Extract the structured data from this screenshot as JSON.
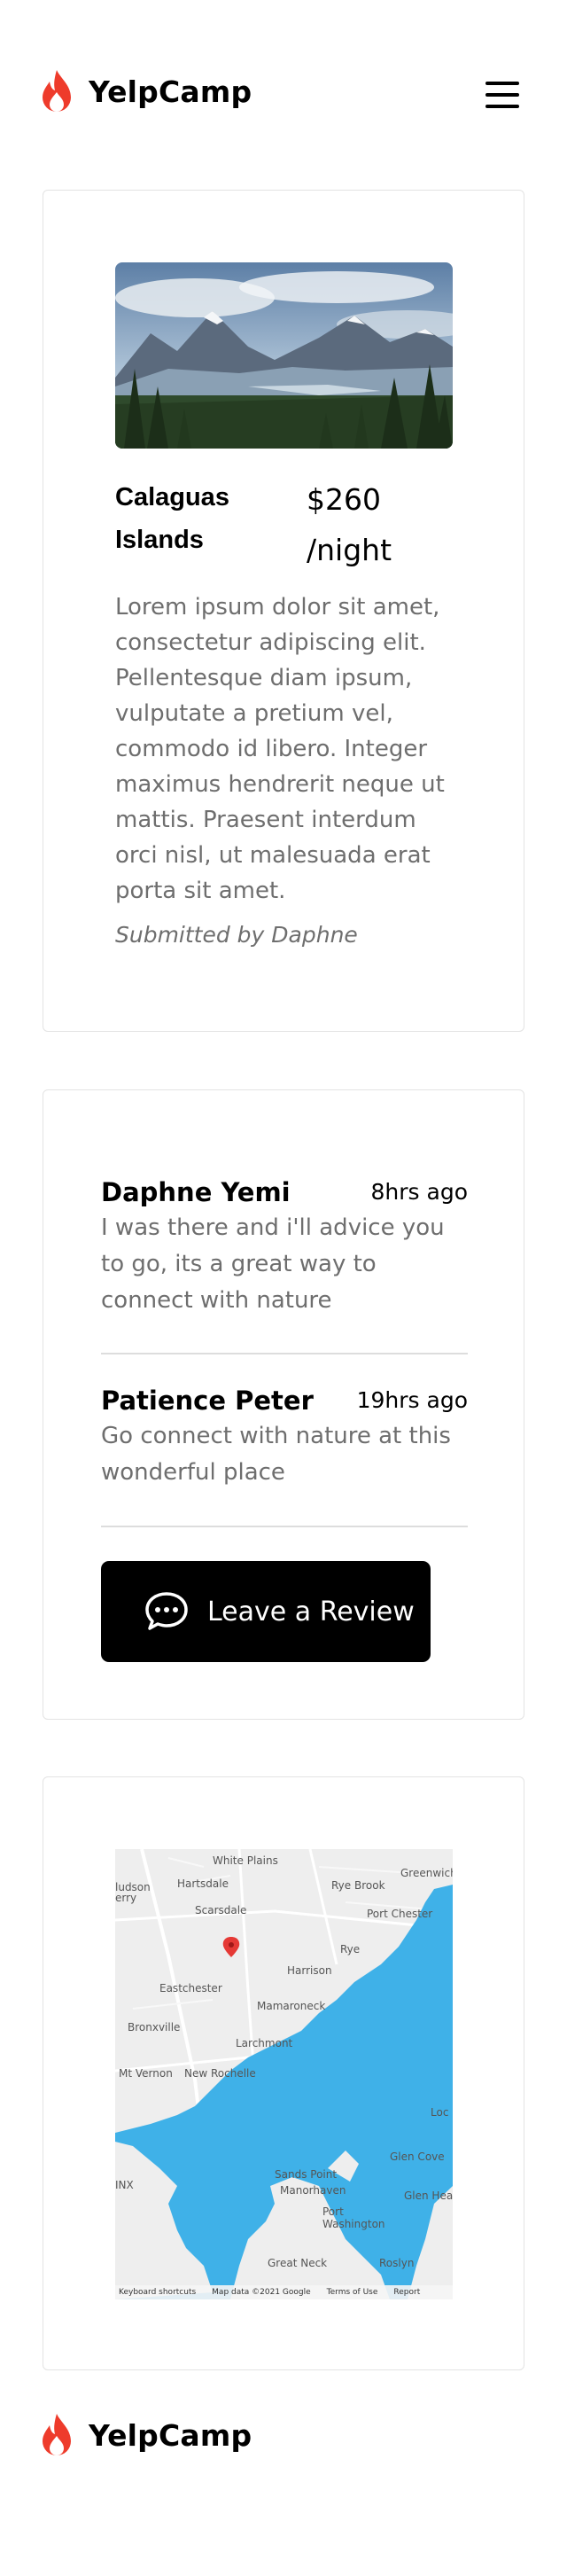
{
  "header": {
    "logo_icon": "flame-icon",
    "brand": "YelpCamp",
    "menu_icon": "hamburger-menu-icon"
  },
  "campground": {
    "image_alt": "mountain-lake-forest-photo",
    "title": "Calaguas Islands",
    "price": "$260 /night",
    "description": "Lorem ipsum dolor sit amet, consectetur adipiscing elit. Pellentesque diam ipsum, vulputate a pretium vel, commodo id libero. Integer maximus hendrerit neque ut mattis. Praesent interdum orci nisl, ut malesuada erat porta sit amet.",
    "submitted_by": "Submitted by Daphne"
  },
  "reviews": [
    {
      "name": "Daphne Yemi",
      "time": "8hrs ago",
      "text": "I was there and i'll advice you to go, its a great way to connect with nature"
    },
    {
      "name": "Patience Peter",
      "time": "19hrs ago",
      "text": "Go connect with nature at this wonderful place"
    }
  ],
  "review_button": {
    "icon": "chat-bubble-icon",
    "label": "Leave a Review"
  },
  "map": {
    "labels": [
      "White Plains",
      "Greenwich",
      "Hartsdale",
      "Rye Brook",
      "Scarsdale",
      "Port Chester",
      "Rye",
      "Harrison",
      "Eastchester",
      "Mamaroneck",
      "Bronxville",
      "Larchmont",
      "Mt Vernon",
      "New Rochelle",
      "Glen Cove",
      "Glen Head",
      "Sands Point",
      "Manorhaven",
      "Port Washington",
      "Great Neck",
      "Roslyn",
      "Loc",
      "ludson",
      "erry",
      "INX"
    ],
    "footer": [
      "Keyboard shortcuts",
      "Map data ©2021 Google",
      "Terms of Use",
      "Report"
    ],
    "colors": {
      "water": "#3fb1e8",
      "land": "#eeeeee",
      "marker": "#e53935"
    }
  },
  "footer": {
    "logo_icon": "flame-icon",
    "brand": "YelpCamp"
  }
}
